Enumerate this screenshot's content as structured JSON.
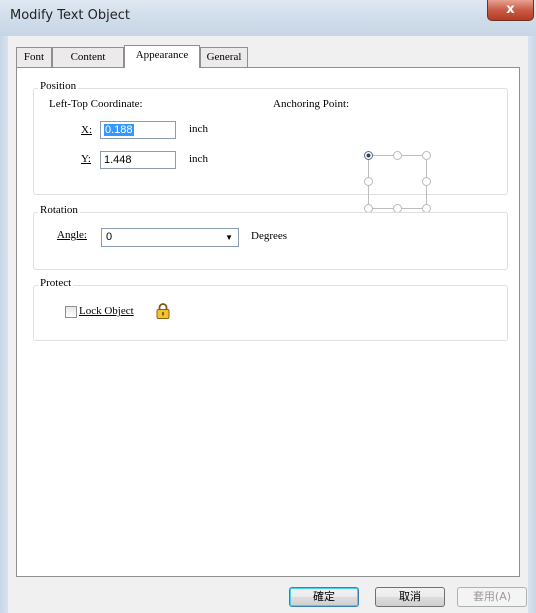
{
  "window": {
    "title": "Modify Text Object",
    "close_label": "x"
  },
  "tabs": [
    {
      "label": "Font",
      "active": false
    },
    {
      "label": "Content",
      "active": false
    },
    {
      "label": "Appearance",
      "active": true
    },
    {
      "label": "General",
      "active": false
    }
  ],
  "position": {
    "group_title": "Position",
    "coord_label": "Left-Top Coordinate:",
    "x_label": "X:",
    "x_value": "0.188",
    "y_label": "Y:",
    "y_value": "1.448",
    "unit": "inch",
    "anchor_label": "Anchoring Point:",
    "anchor_selected": "top-left"
  },
  "rotation": {
    "group_title": "Rotation",
    "angle_label": "Angle:",
    "angle_value": "0",
    "unit": "Degrees"
  },
  "protect": {
    "group_title": "Protect",
    "lock_label": "Lock Object",
    "lock_checked": false,
    "lock_icon": "padlock-icon"
  },
  "buttons": {
    "ok": "確定",
    "cancel": "取消",
    "apply": "套用(A)"
  },
  "colors": {
    "title_bar": "#cfdcea",
    "selection": "#3399ff",
    "close_button": "#c95c46"
  }
}
